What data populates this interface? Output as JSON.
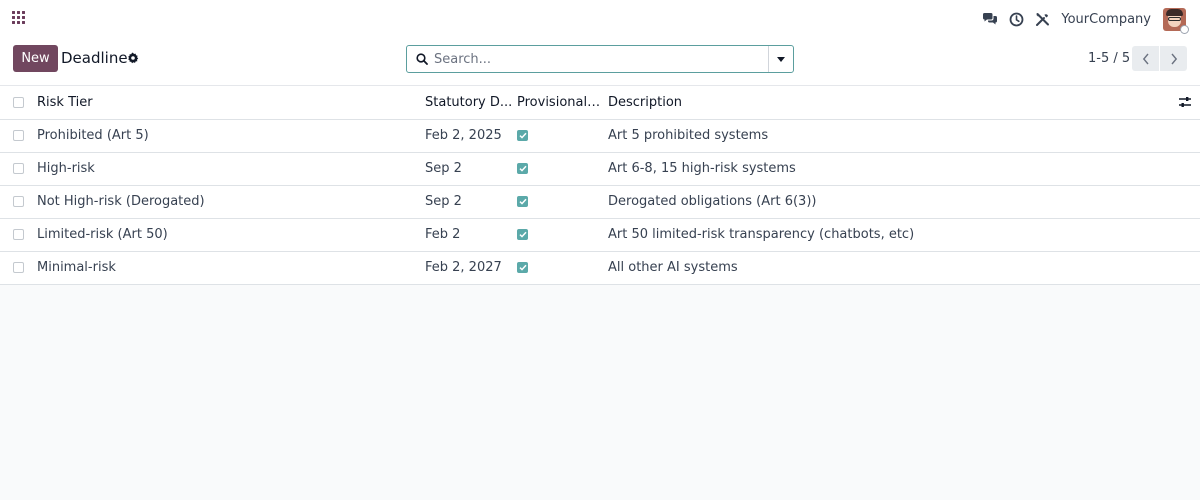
{
  "navbar": {
    "company": "YourCompany",
    "icons": [
      "apps-icon",
      "chat-icon",
      "clock-icon",
      "tools-icon"
    ]
  },
  "control_panel": {
    "new_label": "New",
    "title": "Deadline",
    "search_placeholder": "Search...",
    "pager": "1-5 / 5"
  },
  "table": {
    "columns": [
      "Risk Tier",
      "Statutory D...",
      "Provisional (...",
      "Description"
    ],
    "rows": [
      {
        "tier": "Prohibited (Art 5)",
        "date": "Feb 2, 2025",
        "provisional": true,
        "description": "Art 5 prohibited systems"
      },
      {
        "tier": "High-risk",
        "date": "Sep 2",
        "provisional": true,
        "description": "Art 6-8, 15 high-risk systems"
      },
      {
        "tier": "Not High-risk (Derogated)",
        "date": "Sep 2",
        "provisional": true,
        "description": "Derogated obligations (Art 6(3))"
      },
      {
        "tier": "Limited-risk (Art 50)",
        "date": "Feb 2",
        "provisional": true,
        "description": "Art 50 limited-risk transparency (chatbots, etc)"
      },
      {
        "tier": "Minimal-risk",
        "date": "Feb 2, 2027",
        "provisional": true,
        "description": "All other AI systems"
      }
    ]
  },
  "colors": {
    "brand": "#71475f",
    "accent": "#5ba9a9",
    "search_border": "#5b9e9e"
  }
}
